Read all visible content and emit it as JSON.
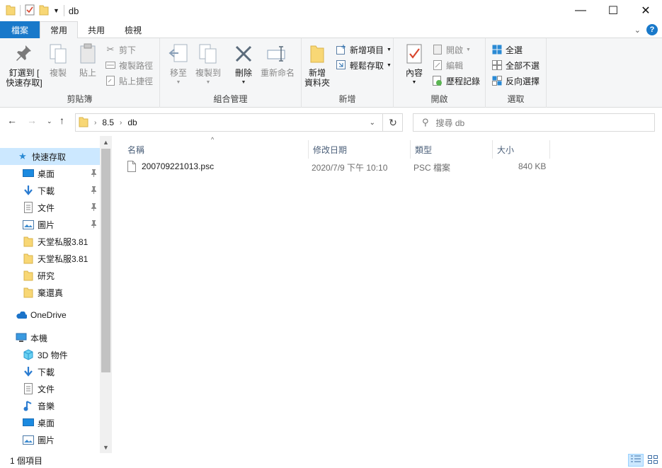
{
  "window": {
    "title": "db",
    "minimize": "—",
    "maximize": "☐",
    "close": "✕"
  },
  "ribbon_tabs": [
    "檔案",
    "常用",
    "共用",
    "檢視"
  ],
  "ribbon": {
    "clipboard": {
      "label": "剪貼簿",
      "pin_line1": "釘選到 [",
      "pin_line2": "快速存取]",
      "copy": "複製",
      "paste": "貼上",
      "cut": "剪下",
      "copy_path": "複製路徑",
      "paste_shortcut": "貼上捷徑"
    },
    "organize": {
      "label": "組合管理",
      "move_to": "移至",
      "copy_to": "複製到",
      "delete": "刪除",
      "rename": "重新命名"
    },
    "new": {
      "label": "新增",
      "new_folder_line1": "新增",
      "new_folder_line2": "資料夾",
      "new_item": "新增項目",
      "easy_access": "輕鬆存取"
    },
    "open": {
      "label": "開啟",
      "properties": "內容",
      "open": "開啟",
      "edit": "編輯",
      "history": "歷程記錄"
    },
    "select": {
      "label": "選取",
      "select_all": "全選",
      "select_none": "全部不選",
      "invert": "反向選擇"
    }
  },
  "address": {
    "path": [
      "8.5",
      "db"
    ],
    "search_placeholder": "搜尋 db"
  },
  "navigation": {
    "quick_access": "快速存取",
    "quick_items": [
      {
        "label": "桌面",
        "icon": "desktop-icon",
        "pinned": true
      },
      {
        "label": "下載",
        "icon": "download-icon",
        "pinned": true
      },
      {
        "label": "文件",
        "icon": "documents-icon",
        "pinned": true
      },
      {
        "label": "圖片",
        "icon": "pictures-icon",
        "pinned": true
      },
      {
        "label": "天堂私服3.81",
        "icon": "folder-icon",
        "pinned": false
      },
      {
        "label": "天堂私服3.81",
        "icon": "folder-icon",
        "pinned": false
      },
      {
        "label": "研究",
        "icon": "folder-icon",
        "pinned": false
      },
      {
        "label": "棄還真",
        "icon": "folder-icon",
        "pinned": false
      }
    ],
    "onedrive": "OneDrive",
    "this_pc": "本機",
    "pc_items": [
      {
        "label": "3D 物件",
        "icon": "3d-objects-icon"
      },
      {
        "label": "下載",
        "icon": "download-icon"
      },
      {
        "label": "文件",
        "icon": "documents-icon"
      },
      {
        "label": "音樂",
        "icon": "music-icon"
      },
      {
        "label": "桌面",
        "icon": "desktop-icon"
      },
      {
        "label": "圖片",
        "icon": "pictures-icon"
      }
    ]
  },
  "columns": [
    "名稱",
    "修改日期",
    "類型",
    "大小"
  ],
  "files": [
    {
      "name": "200709221013.psc",
      "modified": "2020/7/9 下午 10:10",
      "type": "PSC 檔案",
      "size": "840 KB"
    }
  ],
  "status": {
    "item_count": "1 個項目"
  },
  "colors": {
    "accent": "#1979ca",
    "selection": "#cce8ff",
    "folder": "#f8d775"
  }
}
